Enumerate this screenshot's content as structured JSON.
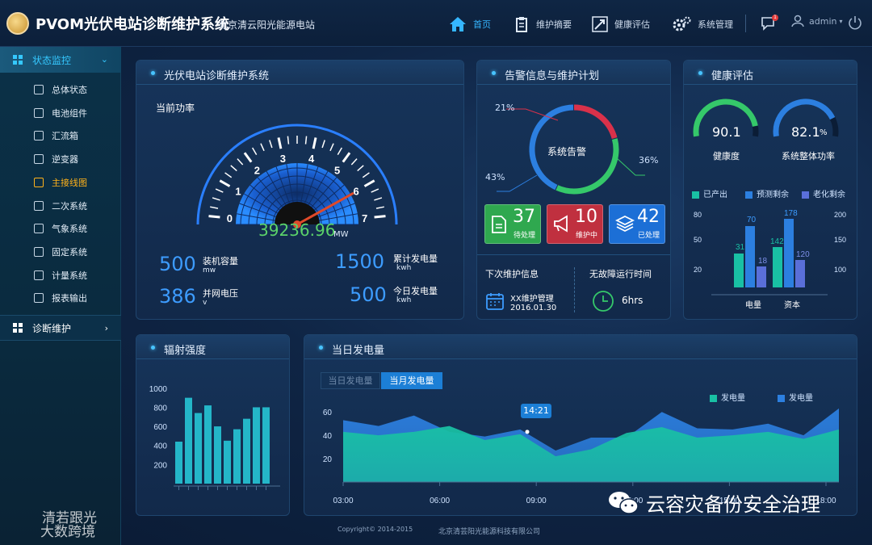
{
  "header": {
    "app_title": "PVOM光伏电站诊断维护系统",
    "station": "北京清云阳光能源电站",
    "nav": [
      {
        "label": "首页",
        "icon": "home-icon"
      },
      {
        "label": "维护摘要",
        "icon": "clipboard-icon"
      },
      {
        "label": "健康评估",
        "icon": "trend-icon"
      },
      {
        "label": "系统管理",
        "icon": "gear-icon"
      }
    ],
    "message_count": "1",
    "user": "admin",
    "accent": "#35b6ff"
  },
  "sidebar": {
    "section1": "状态监控",
    "items": [
      {
        "label": "总体状态"
      },
      {
        "label": "电池组件"
      },
      {
        "label": "汇流箱"
      },
      {
        "label": "逆变器"
      },
      {
        "label": "主接线图"
      },
      {
        "label": "二次系统"
      },
      {
        "label": "气象系统"
      },
      {
        "label": "固定系统"
      },
      {
        "label": "计量系统"
      },
      {
        "label": "报表输出"
      }
    ],
    "active_index": 4,
    "section2": "诊断维护"
  },
  "overview": {
    "title": "光伏电站诊断维护系统",
    "power_label": "当前功率",
    "power_value": "39236.96",
    "power_unit": "MW",
    "gauge_ticks": [
      "0",
      "1",
      "2",
      "3",
      "4",
      "5",
      "6",
      "7"
    ],
    "gauge_level": 0.86,
    "stats": [
      {
        "value": "500",
        "label": "装机容量",
        "unit": "mw"
      },
      {
        "value": "386",
        "label": "并网电压",
        "unit": "v"
      },
      {
        "value": "1500",
        "label": "累计发电量",
        "unit": "kwh"
      },
      {
        "value": "500",
        "label": "今日发电量",
        "unit": "kwh"
      }
    ]
  },
  "alarm": {
    "title": "告警信息与维护计划",
    "donut_label": "系统告警",
    "slices": [
      {
        "pct": "21%",
        "value": 21,
        "color": "#d9314a"
      },
      {
        "pct": "36%",
        "value": 36,
        "color": "#35c86a"
      },
      {
        "pct": "43%",
        "value": 43,
        "color": "#2c7fe0"
      }
    ],
    "tiles": [
      {
        "count": "37",
        "label": "待处理",
        "color": "#2fa84f"
      },
      {
        "count": "10",
        "label": "维护中",
        "color": "#c0303f"
      },
      {
        "count": "42",
        "label": "已处理",
        "color": "#1c6fd6"
      }
    ],
    "next_title": "下次维护信息",
    "next_name": "XX维护管理",
    "next_date": "2016.01.30",
    "uptime_title": "无故障运行时间",
    "uptime_value": "6hrs"
  },
  "health": {
    "title": "健康评估",
    "gauges": [
      {
        "value": "90.1",
        "label": "健康度",
        "level": 0.901,
        "color": "#35c86a"
      },
      {
        "value": "82.1",
        "suffix": "%",
        "label": "系统整体功率",
        "level": 0.821,
        "color": "#2c7fe0"
      }
    ],
    "legend": [
      {
        "label": "已产出",
        "color": "#19c0a4"
      },
      {
        "label": "预测剩余",
        "color": "#2c7fe0"
      },
      {
        "label": "老化剩余",
        "color": "#5a6fd9"
      }
    ]
  },
  "radiation": {
    "title": "辐射强度",
    "chart_data": {
      "type": "bar",
      "yticks": [
        "1000",
        "800",
        "600",
        "400",
        "200"
      ],
      "ylim": [
        0,
        1100
      ],
      "values": [
        440,
        900,
        740,
        820,
        600,
        450,
        570,
        680,
        800,
        800
      ],
      "color": "#24b6c8"
    }
  },
  "daily": {
    "title": "当日发电量",
    "tabs": [
      "当日发电量",
      "当月发电量"
    ],
    "active_tab": 1,
    "tooltip": "14:21",
    "legend": [
      {
        "label": "发电量",
        "color": "#19c0a4"
      },
      {
        "label": "发电量",
        "color": "#2c7fe0"
      }
    ],
    "chart_data": {
      "type": "area",
      "yticks": [
        "60",
        "40",
        "20"
      ],
      "ylim": [
        0,
        65
      ],
      "xticks": [
        "03:00",
        "06:00",
        "09:00",
        "12:00",
        "15:00",
        "18:00"
      ],
      "series": [
        {
          "color": "#2c7fe0",
          "values": [
            53,
            48,
            57,
            43,
            39,
            45,
            27,
            38,
            38,
            60,
            46,
            45,
            50,
            40,
            63
          ]
        },
        {
          "color": "#19c0a4",
          "values": [
            43,
            40,
            43,
            48,
            36,
            41,
            22,
            28,
            42,
            47,
            38,
            40,
            43,
            37,
            45
          ]
        }
      ]
    }
  },
  "footer": {
    "copyright": "Copyright© 2014-2015",
    "company": "北京清芸阳光能源科技有限公司"
  },
  "watermarks": {
    "right": "云容灾备份安全治理",
    "left_top": "清若跟光",
    "left_bottom": "大数跨境"
  }
}
